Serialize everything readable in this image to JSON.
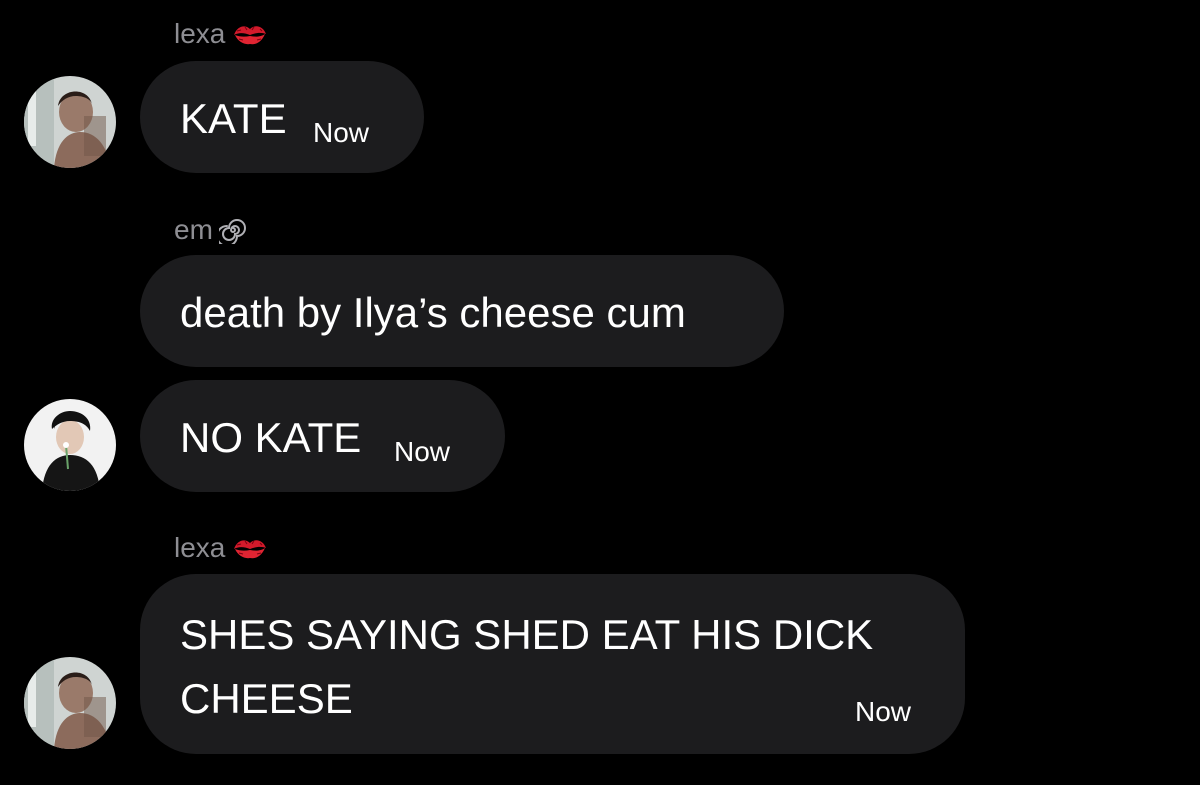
{
  "messages": [
    {
      "sender": "lexa",
      "sender_icon": "kiss-mark-icon",
      "text": "KATE",
      "time": "Now"
    },
    {
      "sender": "em",
      "sender_icon": "spiral-icon",
      "text": "death by Ilya’s cheese cum",
      "time": ""
    },
    {
      "sender": "",
      "sender_icon": "",
      "text": "NO KATE",
      "time": "Now"
    },
    {
      "sender": "lexa",
      "sender_icon": "kiss-mark-icon",
      "text_line1": "SHES SAYING SHED EAT HIS DICK",
      "text_line2": "CHEESE",
      "time": "Now"
    }
  ],
  "colors": {
    "background": "#000000",
    "bubble": "#1c1c1e",
    "sender_name": "#8e8e93",
    "kiss": "#d21a2b"
  }
}
